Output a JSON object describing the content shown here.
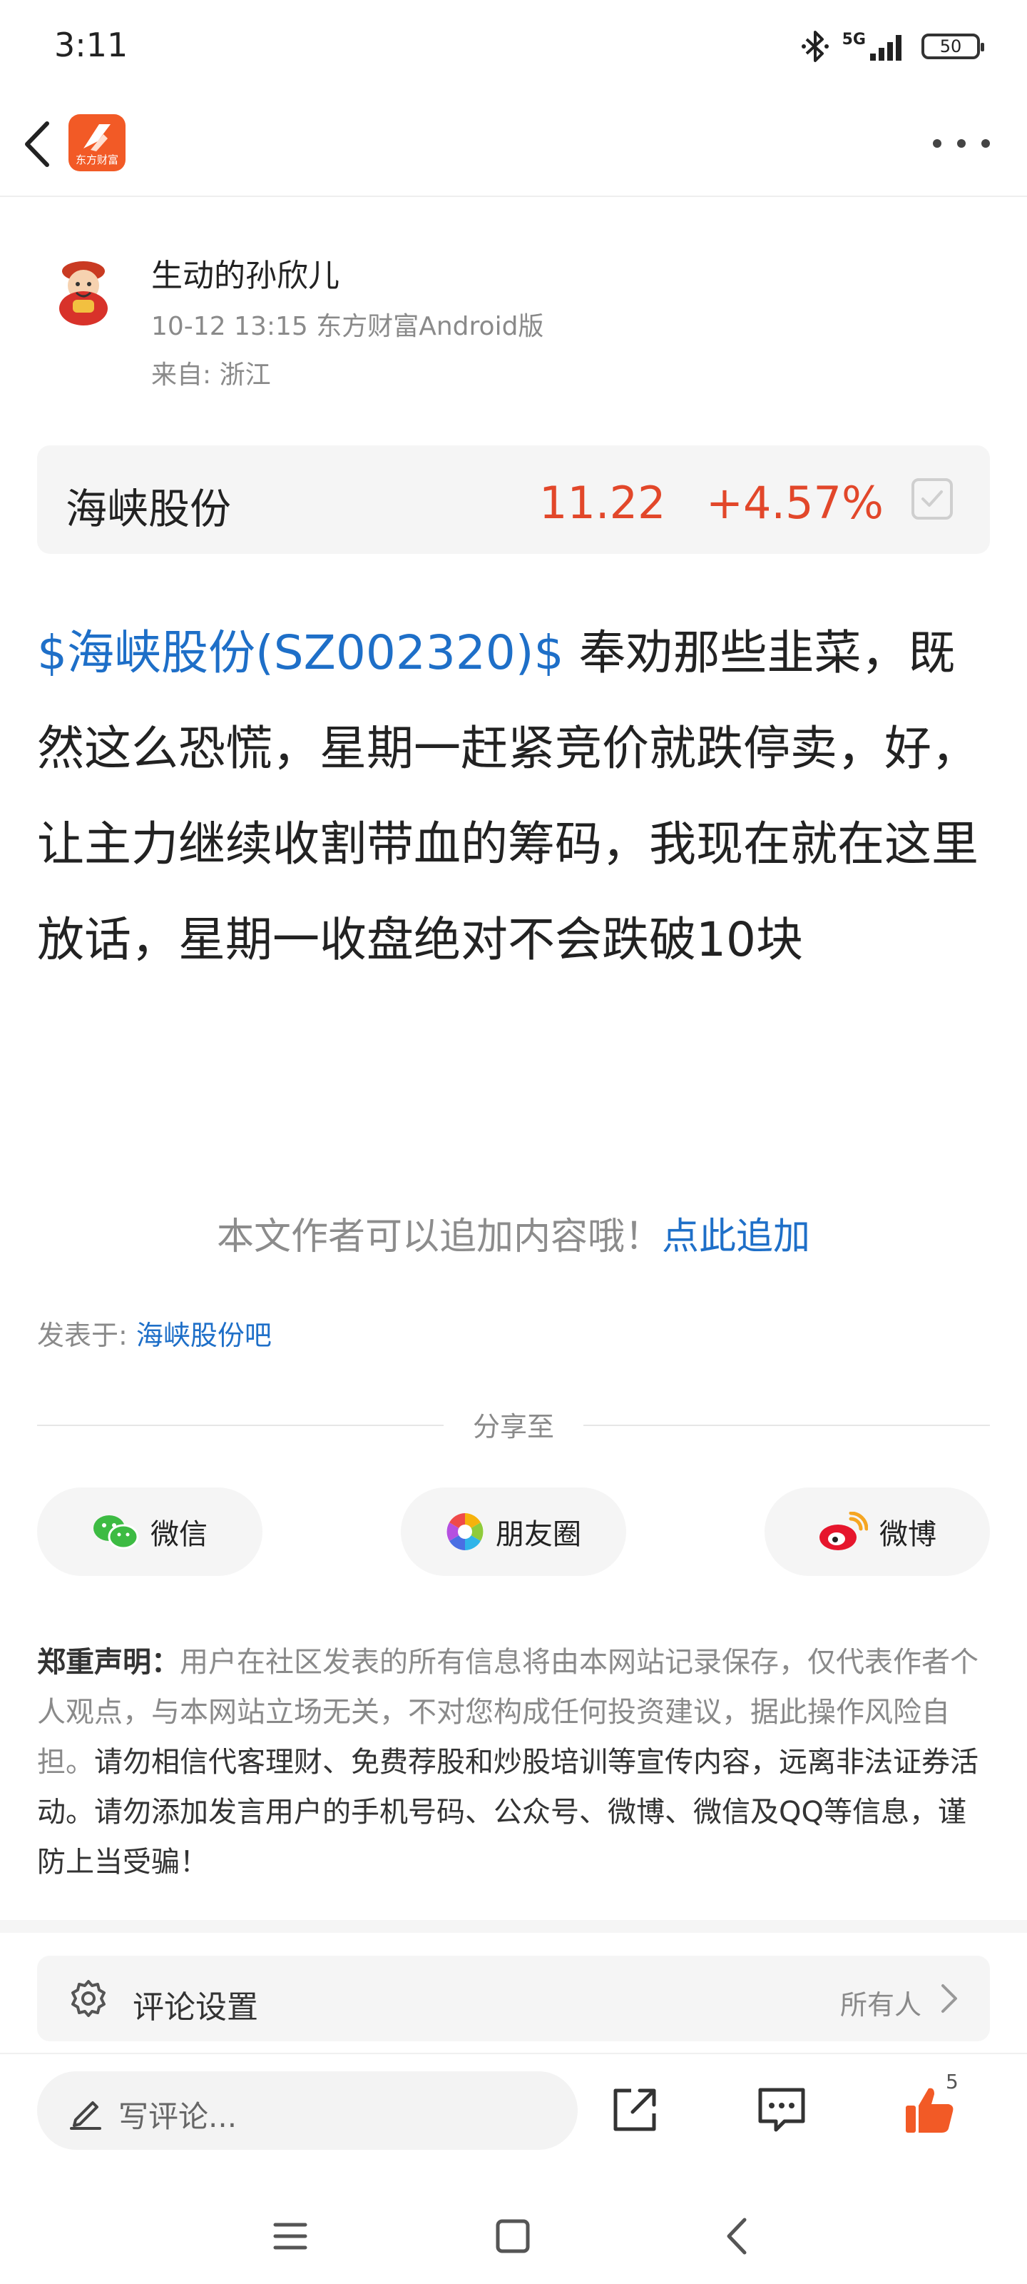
{
  "status_bar": {
    "time": "3:11",
    "network": "5G",
    "battery": "50",
    "icons": [
      "bluetooth-icon",
      "signal-icon",
      "battery-icon"
    ]
  },
  "app_bar": {
    "logo_text": "东方财富",
    "icons": [
      "back-arrow-icon",
      "app-logo",
      "more-dots-icon"
    ]
  },
  "post": {
    "author_name": "生动的孙欣儿",
    "meta": "10-12 13:15 东方财富Android版",
    "location": "来自: 浙江",
    "stock": {
      "name": "海峡股份",
      "price": "11.22",
      "change": "+4.57%"
    },
    "content_tag": "$海峡股份(SZ002320)$",
    "content_text": " 奉劝那些韭菜，既然这么恐慌，星期一赶紧竞价就跌停卖，好，让主力继续收割带血的筹码，我现在就在这里放话，星期一收盘绝对不会跌破10块",
    "append_tip": "本文作者可以追加内容哦！",
    "append_link": "点此追加",
    "posted_in_label": "发表于: ",
    "posted_in_link": "海峡股份吧"
  },
  "share": {
    "label": "分享至",
    "buttons": [
      "微信",
      "朋友圈",
      "微博"
    ]
  },
  "disclaimer": {
    "title": "郑重声明：",
    "text1": "用户在社区发表的所有信息将由本网站记录保存，仅代表作者个人观点，与本网站立场无关，不对您构成任何投资建议，据此操作风险自担。",
    "text2": "请勿相信代客理财、免费荐股和炒股培训等宣传内容，远离非法证券活动。请勿添加发言用户的手机号码、公众号、微博、微信及QQ等信息，谨防上当受骗！"
  },
  "comment_settings": {
    "label": "评论设置",
    "value": "所有人"
  },
  "bottom_bar": {
    "write_placeholder": "写评论...",
    "like_count": "5"
  },
  "colors": {
    "accent_red": "#e2472a",
    "link_blue": "#1e6fc8",
    "brand_orange": "#f25a26",
    "like_orange": "#f25a26"
  }
}
